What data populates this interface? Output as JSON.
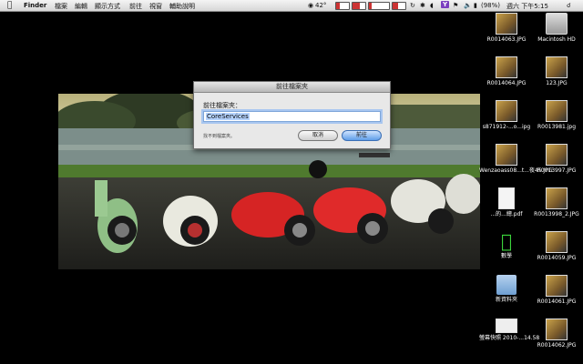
{
  "menubar": {
    "app": "Finder",
    "items": [
      "檔案",
      "編輯",
      "顯示方式",
      "前往",
      "視窗",
      "輔助說明"
    ],
    "temperature": "42°",
    "battery": "(98%)",
    "clock": "週六 下午5:15"
  },
  "dialog": {
    "title": "前往檔案夾",
    "prompt": "前往檔案夾：",
    "value": "CoreServices",
    "note": "找不到檔案夾。",
    "cancel_label": "取消",
    "go_label": "前往"
  },
  "desktop": {
    "col1": [
      {
        "label": "R0014063.JPG",
        "kind": "photo"
      },
      {
        "label": "R0014064.JPG",
        "kind": "photo"
      },
      {
        "label": "s871912-...o...ipg",
        "kind": "photo"
      },
      {
        "label": "Wenzaoass08...t...夜45.JPG",
        "kind": "photo"
      },
      {
        "label": "...的...總.pdf",
        "kind": "document"
      },
      {
        "label": "數學",
        "kind": "apple"
      },
      {
        "label": "新資料夾",
        "kind": "folder"
      },
      {
        "label": "螢幕快照 2010-...14.58",
        "kind": "screenshot"
      }
    ],
    "col2": [
      {
        "label": "Macintosh HD",
        "kind": "drive"
      },
      {
        "label": "123.JPG",
        "kind": "photo"
      },
      {
        "label": "R0013981.jpg",
        "kind": "photo"
      },
      {
        "label": "R0013997.JPG",
        "kind": "photo"
      },
      {
        "label": "R0013998_2.JPG",
        "kind": "photo"
      },
      {
        "label": "R0014059.JPG",
        "kind": "photo"
      },
      {
        "label": "R0014061.JPG",
        "kind": "photo"
      },
      {
        "label": "R0014062.JPG",
        "kind": "photo"
      }
    ]
  },
  "colors": {
    "accent": "#5f9de8",
    "desktop_bg": "#000000"
  }
}
